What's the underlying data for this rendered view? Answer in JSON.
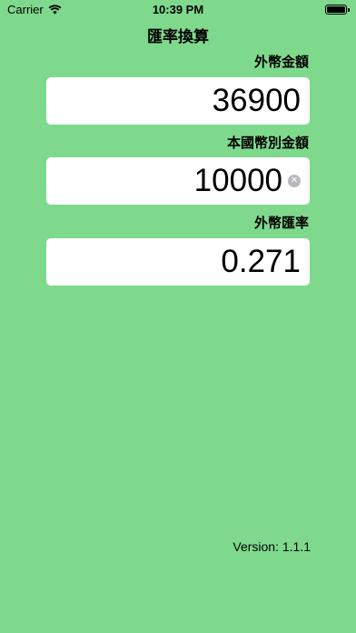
{
  "status_bar": {
    "carrier": "Carrier",
    "time": "10:39 PM",
    "icons": [
      "wifi-icon",
      "battery-icon"
    ]
  },
  "page": {
    "title": "匯率換算"
  },
  "fields": {
    "foreign_amount": {
      "label": "外幣金額",
      "value": "36900"
    },
    "local_amount": {
      "label": "本國幣別金額",
      "value": "10000"
    },
    "exchange_rate": {
      "label": "外幣匯率",
      "value": "0.271"
    }
  },
  "footer": {
    "version": "Version: 1.1.1"
  },
  "colors": {
    "background": "#7fd98d",
    "field_background": "#ffffff",
    "clear_button": "#b8b8bd"
  }
}
